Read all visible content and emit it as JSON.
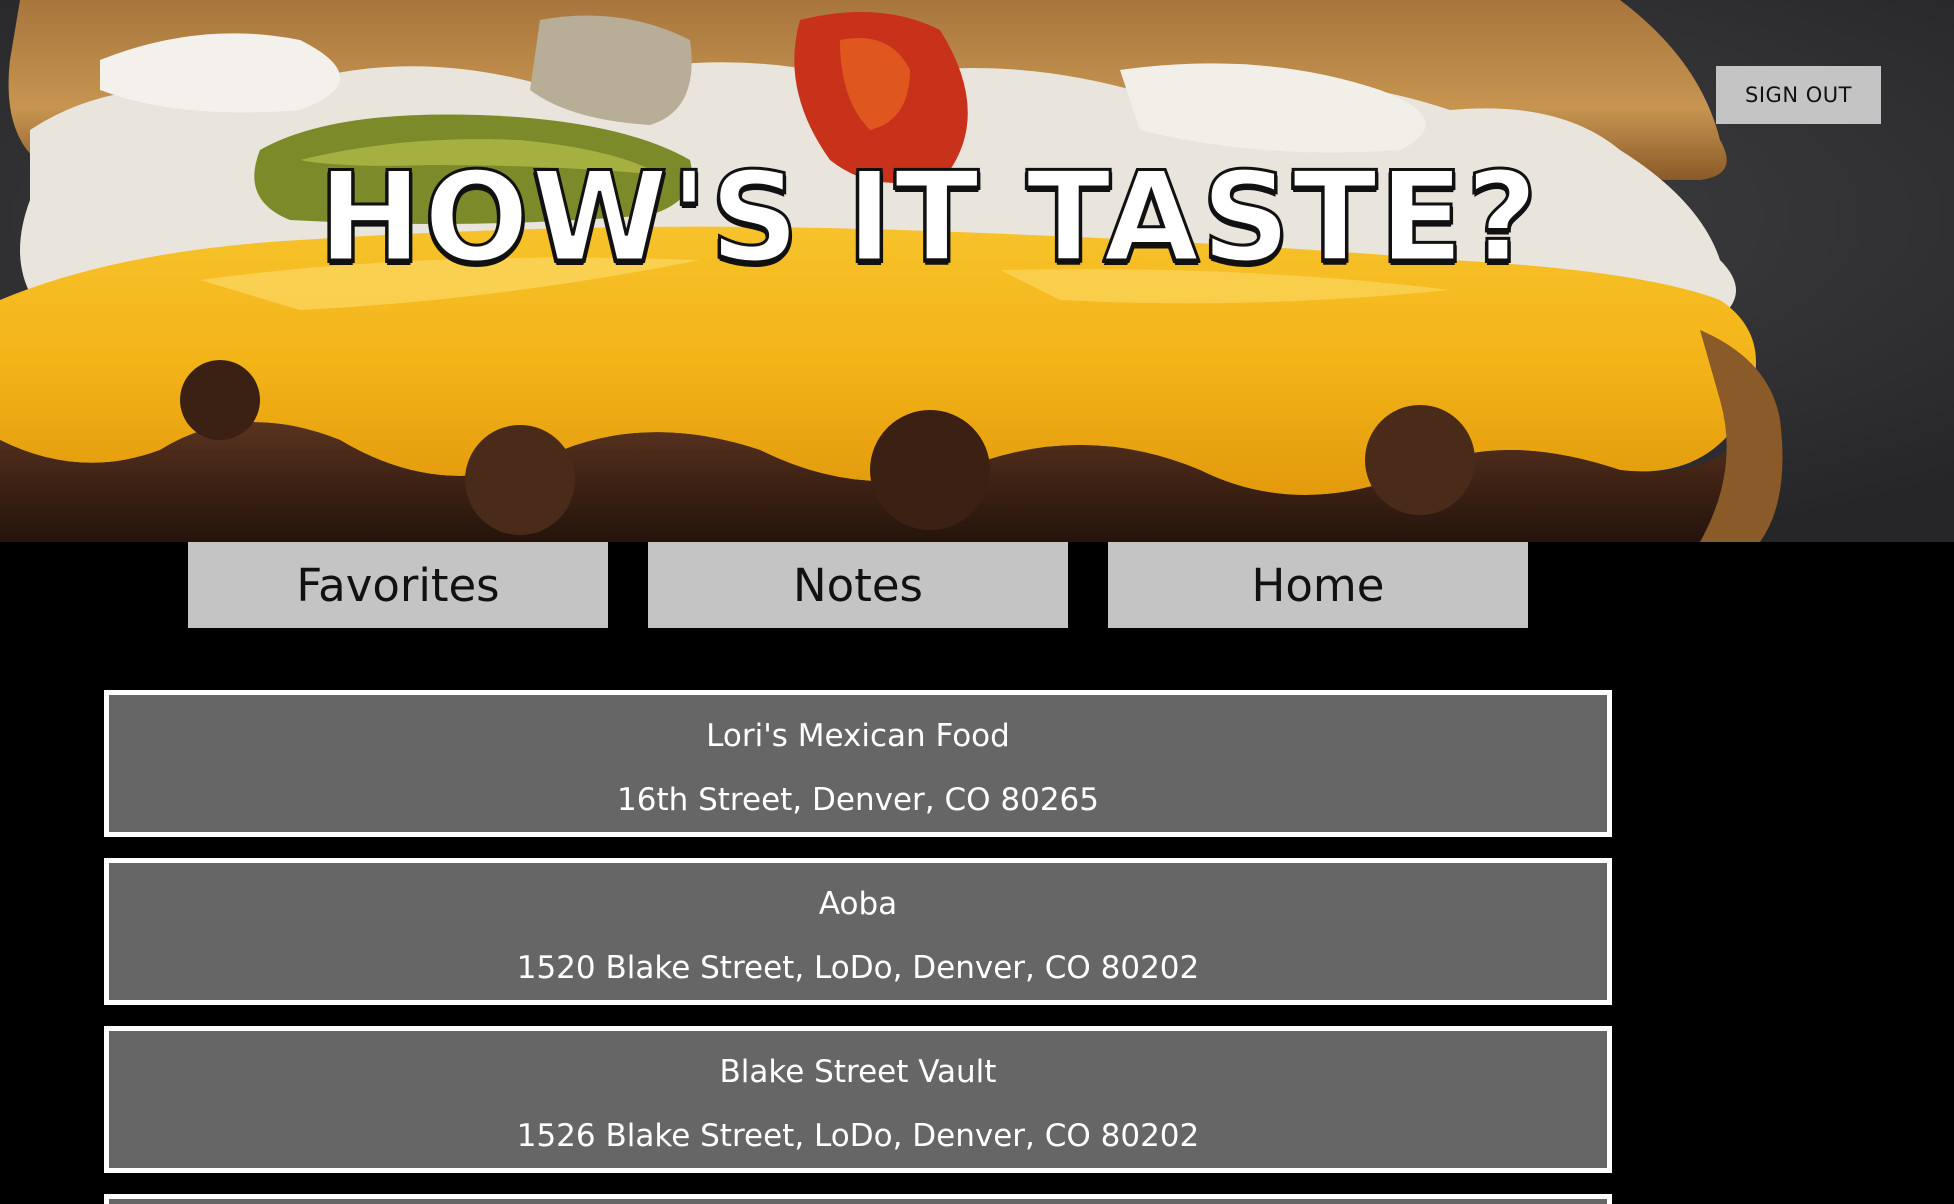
{
  "app": {
    "title": "HOW'S IT TASTE?"
  },
  "header": {
    "sign_out_label": "SIGN OUT",
    "hero_image": "burger-photo"
  },
  "nav": {
    "items": [
      {
        "label": "Favorites"
      },
      {
        "label": "Notes"
      },
      {
        "label": "Home"
      }
    ]
  },
  "restaurants": [
    {
      "name": "Lori's Mexican Food",
      "address": "16th Street, Denver, CO 80265"
    },
    {
      "name": "Aoba",
      "address": "1520 Blake Street, LoDo, Denver, CO 80202"
    },
    {
      "name": "Blake Street Vault",
      "address": "1526 Blake Street, LoDo, Denver, CO 80202"
    }
  ],
  "colors": {
    "page_background": "#000000",
    "button_background": "#c4c4c4",
    "card_background": "#666666",
    "card_border": "#ffffff"
  }
}
